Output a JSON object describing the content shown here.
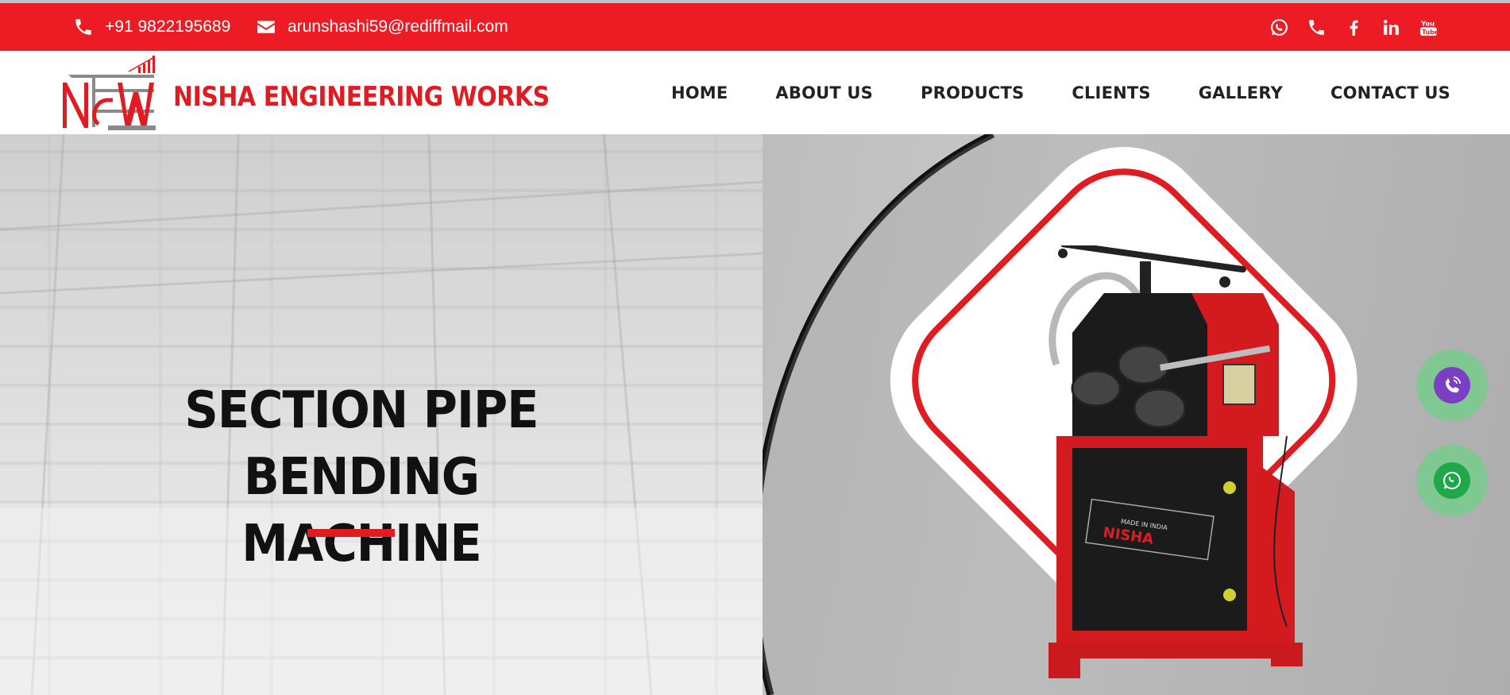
{
  "topbar": {
    "phone": "+91 9822195689",
    "email": "arunshashi59@rediffmail.com",
    "phone_icon": "phone-icon",
    "email_icon": "envelope-icon",
    "social_icons": [
      "whatsapp-icon",
      "phone-icon",
      "facebook-icon",
      "linkedin-icon",
      "youtube-icon"
    ]
  },
  "header": {
    "logo_text": "NEW",
    "brand_name": "NISHA ENGINEERING WORKS",
    "nav": [
      "HOME",
      "ABOUT US",
      "PRODUCTS",
      "CLIENTS",
      "GALLERY",
      "CONTACT US"
    ]
  },
  "hero": {
    "title_line1": "SECTION PIPE",
    "title_line2": "BENDING MACHINE",
    "machine_label": "NISHA",
    "machine_made_in": "MADE IN INDIA"
  },
  "floating": {
    "call_icon": "viber-call-icon",
    "whatsapp_icon": "whatsapp-icon"
  },
  "colors": {
    "brand_red": "#ed1c24",
    "text_dark": "#222222",
    "viber_purple": "#7b3fc4",
    "whatsapp_green": "#1fa84a"
  }
}
